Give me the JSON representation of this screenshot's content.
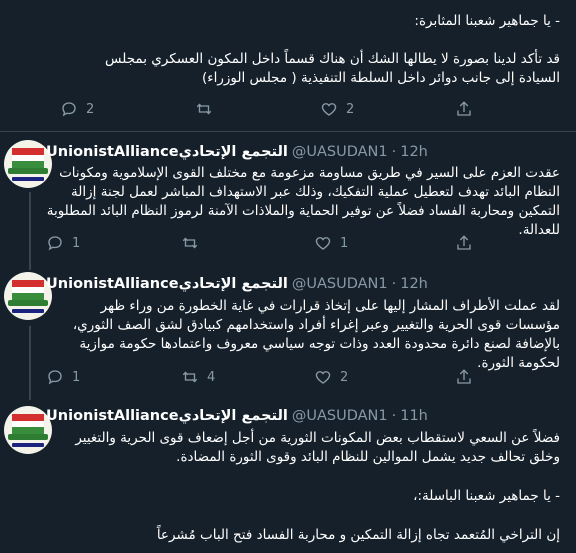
{
  "tweet0": {
    "text_line1": "- يا جماهير شعبنا المثابرة:",
    "text_body": "قد تأكد لدينا بصورة لا يطالها الشك أن هناك قسماً داخل المكون العسكري بمجلس السيادة إلى جانب دوائر داخل السلطة التنفيذية ( مجلس الوزراء)",
    "reply_count": "2",
    "retweet_count": "",
    "like_count": "2"
  },
  "tweet1": {
    "display_name": "UnionistAllianceالتجمع الإتحادي",
    "handle": "@UASUDAN1",
    "time": "12h",
    "text": "عقدت العزم على السير في طريق مساومة مزعومة مع مختلف القوى الإسلاموية ومكونات النظام البائد تهدف لتعطيل عملية التفكيك، وذلك عبر الاستهداف المباشر لعمل لجنة إزالة التمكين ومحاربة الفساد فضلاً عن توفير الحماية والملاذات الآمنة لرموز النظام البائد المطلوبة للعدالة.",
    "reply_count": "1",
    "retweet_count": "",
    "like_count": "1"
  },
  "tweet2": {
    "display_name": "UnionistAllianceالتجمع الإتحادي",
    "handle": "@UASUDAN1",
    "time": "12h",
    "text": "لقد  عملت الأطراف المشار إليها على إتخاذ قرارات في غاية الخطورة من وراء ظهر مؤسسات قوى الحرية والتغيير وعبر إغراء أفراد واستخدامهم كبيادق لشق الصف الثوري، بالإضافة لصنع دائرة محدودة العدد وذات توجه سياسي معروف واعتمادها حكومة موازية لحكومة الثورة.",
    "reply_count": "1",
    "retweet_count": "4",
    "like_count": "2"
  },
  "tweet3": {
    "display_name": "UnionistAllianceالتجمع الإتحادي",
    "handle": "@UASUDAN1",
    "time": "11h",
    "text_para1": "فضلاً عن السعي لاستقطاب بعض المكونات الثورية من أجل إضعاف قوى الحرية والتغيير وخلق تحالف جديد يشمل الموالين للنظام البائد وقوى الثورة المضادة.",
    "text_para2": "- يا جماهير شعبنا الباسلة:،",
    "text_para3": "إن التراخي المُتعمد تجاه إزالة  التمكين و محاربة الفساد فتح الباب مُشرعاً"
  },
  "avatar": {
    "flag_colors": [
      "#d32f2f",
      "#ffffff",
      "#388e3c"
    ],
    "text_color": "#2e7d32"
  },
  "theme": {
    "background": "#15202b",
    "muted": "#8899a6",
    "divider": "#38444d"
  }
}
